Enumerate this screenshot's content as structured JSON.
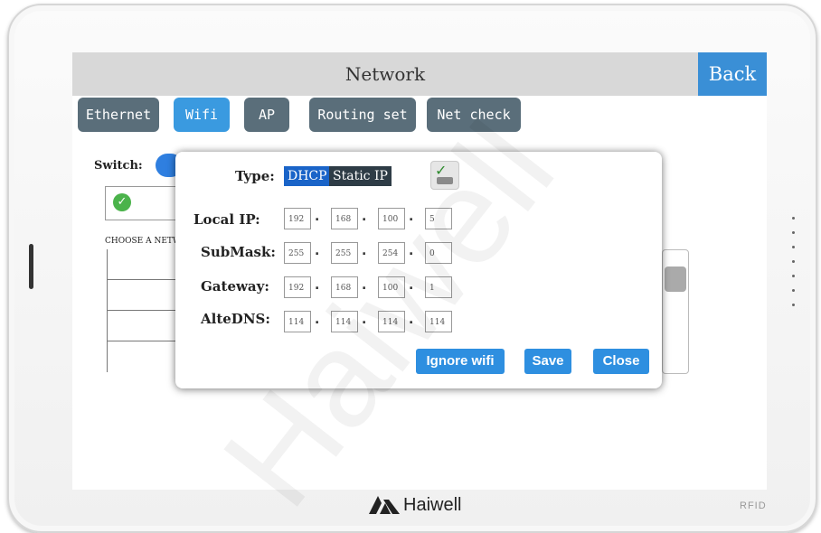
{
  "header": {
    "title": "Network",
    "back_label": "Back"
  },
  "tabs": [
    {
      "label": "Ethernet",
      "active": false
    },
    {
      "label": "Wifi",
      "active": true
    },
    {
      "label": "AP",
      "active": false
    },
    {
      "label": "Routing set",
      "active": false
    },
    {
      "label": "Net check",
      "active": false
    }
  ],
  "background": {
    "switch_label": "Switch:",
    "choose_network_label": "CHOOSE A NETW"
  },
  "dialog": {
    "type_label": "Type:",
    "type_options": [
      "DHCP",
      "Static IP"
    ],
    "selected_type": "DHCP",
    "local_ip": {
      "label": "Local IP:",
      "octets": [
        "192",
        "168",
        "100",
        "5"
      ]
    },
    "submask": {
      "label": "SubMask:",
      "octets": [
        "255",
        "255",
        "254",
        "0"
      ]
    },
    "gateway": {
      "label": "Gateway:",
      "octets": [
        "192",
        "168",
        "100",
        "1"
      ]
    },
    "altedns": {
      "label": "AlteDNS:",
      "octets": [
        "114",
        "114",
        "114",
        "114"
      ]
    },
    "buttons": {
      "ignore": "Ignore wifi",
      "save": "Save",
      "close": "Close"
    }
  },
  "device": {
    "brand": "Haiwell",
    "rfid": "RFID"
  },
  "watermark": "Haiwell",
  "colors": {
    "accent": "#3a8fd6",
    "tab": "#5a6e7a",
    "dhcp": "#1a64c8"
  }
}
